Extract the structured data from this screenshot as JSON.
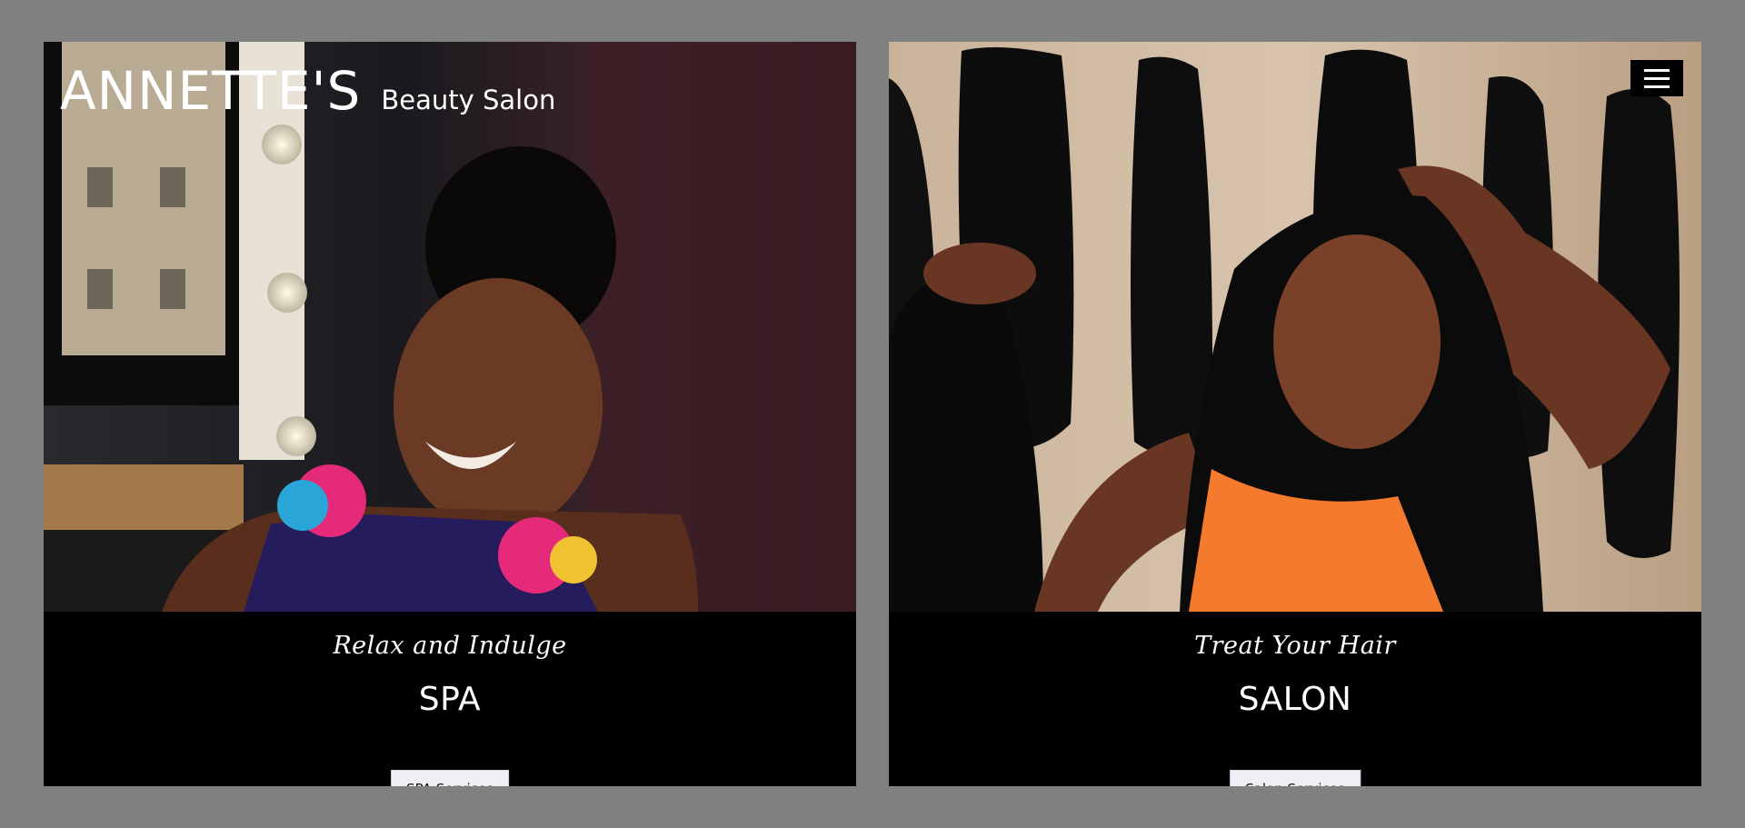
{
  "brand": {
    "name": "ANNETTE'S",
    "subtitle": "Beauty Salon"
  },
  "header": {
    "menu_icon": "hamburger-menu-icon"
  },
  "cards": [
    {
      "tagline": "Relax and Indulge",
      "title": "SPA",
      "button_label": "SPA Services"
    },
    {
      "tagline": "Treat Your Hair",
      "title": "SALON",
      "button_label": "Salon Services"
    }
  ],
  "colors": {
    "page_background": "#808080",
    "caption_background": "#000000",
    "button_background": "#eef0f5",
    "text_light": "#ffffff"
  }
}
